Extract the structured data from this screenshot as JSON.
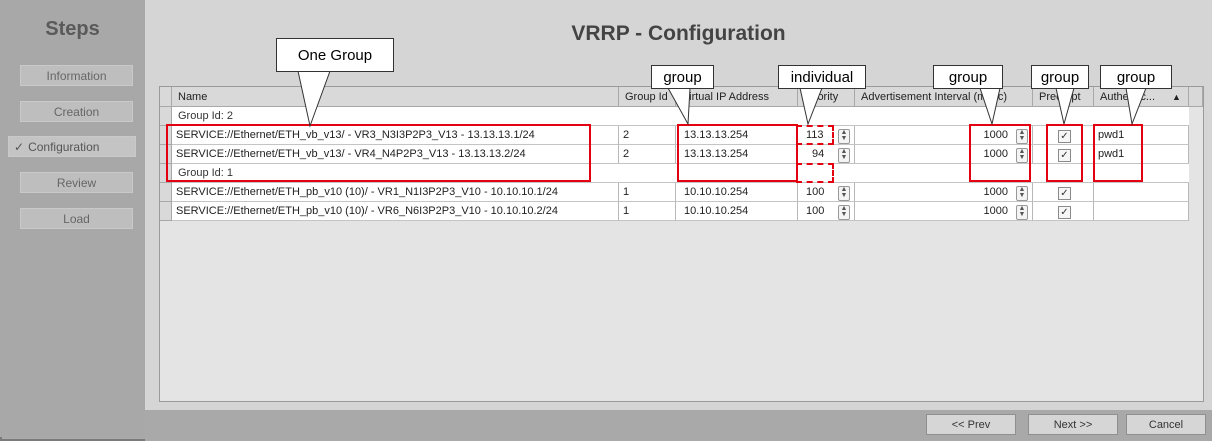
{
  "sidebar": {
    "title": "Steps",
    "items": [
      {
        "label": "Information",
        "active": false
      },
      {
        "label": "Creation",
        "active": false
      },
      {
        "label": "Configuration",
        "active": true
      },
      {
        "label": "Review",
        "active": false
      },
      {
        "label": "Load",
        "active": false
      }
    ]
  },
  "page_title": "VRRP - Configuration",
  "table": {
    "columns": [
      "Name",
      "Group Id",
      "Virtual IP Address",
      "Priority",
      "Advertisement Interval (msec)",
      "Preempt",
      "Authentic..."
    ],
    "groups": [
      {
        "label": "Group Id: 2",
        "rows": [
          {
            "name": "SERVICE://Ethernet/ETH_vb_v13/ - VR3_N3I3P2P3_V13 - 13.13.13.1/24",
            "group_id": "2",
            "vip": "13.13.13.254",
            "priority": "113",
            "interval": "1000",
            "preempt": true,
            "auth": "pwd1"
          },
          {
            "name": "SERVICE://Ethernet/ETH_vb_v13/ - VR4_N4P2P3_V13 - 13.13.13.2/24",
            "group_id": "2",
            "vip": "13.13.13.254",
            "priority": "94",
            "interval": "1000",
            "preempt": true,
            "auth": "pwd1"
          }
        ]
      },
      {
        "label": "Group Id: 1",
        "rows": [
          {
            "name": "SERVICE://Ethernet/ETH_pb_v10 (10)/ - VR1_N1I3P2P3_V10 - 10.10.10.1/24",
            "group_id": "1",
            "vip": "10.10.10.254",
            "priority": "100",
            "interval": "1000",
            "preempt": true,
            "auth": ""
          },
          {
            "name": "SERVICE://Ethernet/ETH_pb_v10 (10)/ - VR6_N6I3P2P3_V10 - 10.10.10.2/24",
            "group_id": "1",
            "vip": "10.10.10.254",
            "priority": "100",
            "interval": "1000",
            "preempt": true,
            "auth": ""
          }
        ]
      }
    ]
  },
  "buttons": {
    "prev": "<< Prev",
    "next": "Next >>",
    "cancel": "Cancel"
  },
  "annotations": {
    "one_group": "One Group",
    "group": "group",
    "individual": "individual"
  },
  "colors": {
    "highlight": "#e3000f"
  }
}
